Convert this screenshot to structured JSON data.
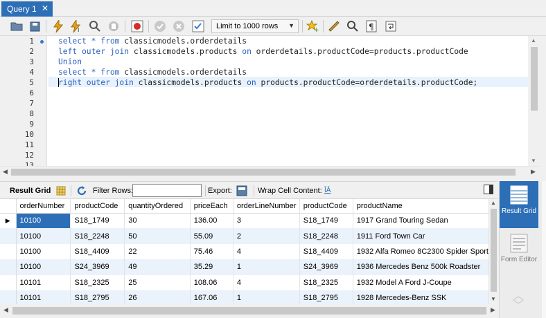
{
  "tab": {
    "title": "Query 1",
    "close": "✕"
  },
  "toolbar": {
    "limit_value": "Limit to 1000 rows"
  },
  "editor": {
    "line_numbers": [
      "1",
      "2",
      "3",
      "4",
      "5",
      "6",
      "7",
      "8",
      "9",
      "10",
      "11",
      "12",
      "13"
    ],
    "lines": [
      [
        {
          "t": "select * from ",
          "c": "kw"
        },
        {
          "t": "classicmodels.orderdetails",
          "c": "id"
        }
      ],
      [
        {
          "t": "left outer join ",
          "c": "kw"
        },
        {
          "t": "classicmodels.products ",
          "c": "id"
        },
        {
          "t": "on ",
          "c": "kw"
        },
        {
          "t": "orderdetails.productCode=products.productCode",
          "c": "id"
        }
      ],
      [
        {
          "t": "Union",
          "c": "kw"
        }
      ],
      [
        {
          "t": "select * from ",
          "c": "kw"
        },
        {
          "t": "classicmodels.orderdetails",
          "c": "id"
        }
      ],
      [
        {
          "t": "right outer join ",
          "c": "kw"
        },
        {
          "t": "classicmodels.products ",
          "c": "id"
        },
        {
          "t": "on ",
          "c": "kw"
        },
        {
          "t": "products.productCode=orderdetails.productCode;",
          "c": "id"
        }
      ]
    ]
  },
  "result_toolbar": {
    "result_grid_label": "Result Grid",
    "filter_rows_label": "Filter Rows:",
    "filter_value": "",
    "export_label": "Export:",
    "wrap_label": "Wrap Cell Content:",
    "wrap_icon_text": "ĪĀ"
  },
  "grid": {
    "columns": [
      "orderNumber",
      "productCode",
      "quantityOrdered",
      "priceEach",
      "orderLineNumber",
      "productCode",
      "productName"
    ],
    "rows": [
      [
        "10100",
        "S18_1749",
        "30",
        "136.00",
        "3",
        "S18_1749",
        "1917 Grand Touring Sedan"
      ],
      [
        "10100",
        "S18_2248",
        "50",
        "55.09",
        "2",
        "S18_2248",
        "1911 Ford Town Car"
      ],
      [
        "10100",
        "S18_4409",
        "22",
        "75.46",
        "4",
        "S18_4409",
        "1932 Alfa Romeo 8C2300 Spider Sport"
      ],
      [
        "10100",
        "S24_3969",
        "49",
        "35.29",
        "1",
        "S24_3969",
        "1936 Mercedes Benz 500k Roadster"
      ],
      [
        "10101",
        "S18_2325",
        "25",
        "108.06",
        "4",
        "S18_2325",
        "1932 Model A Ford J-Coupe"
      ],
      [
        "10101",
        "S18_2795",
        "26",
        "167.06",
        "1",
        "S18_2795",
        "1928 Mercedes-Benz SSK"
      ]
    ]
  },
  "side_panel": {
    "result_grid": "Result Grid",
    "form_editor": "Form Editor"
  },
  "colors": {
    "accent": "#2c6fb7",
    "keyword": "#2d62b8",
    "row_alt": "#eaf2fb"
  }
}
